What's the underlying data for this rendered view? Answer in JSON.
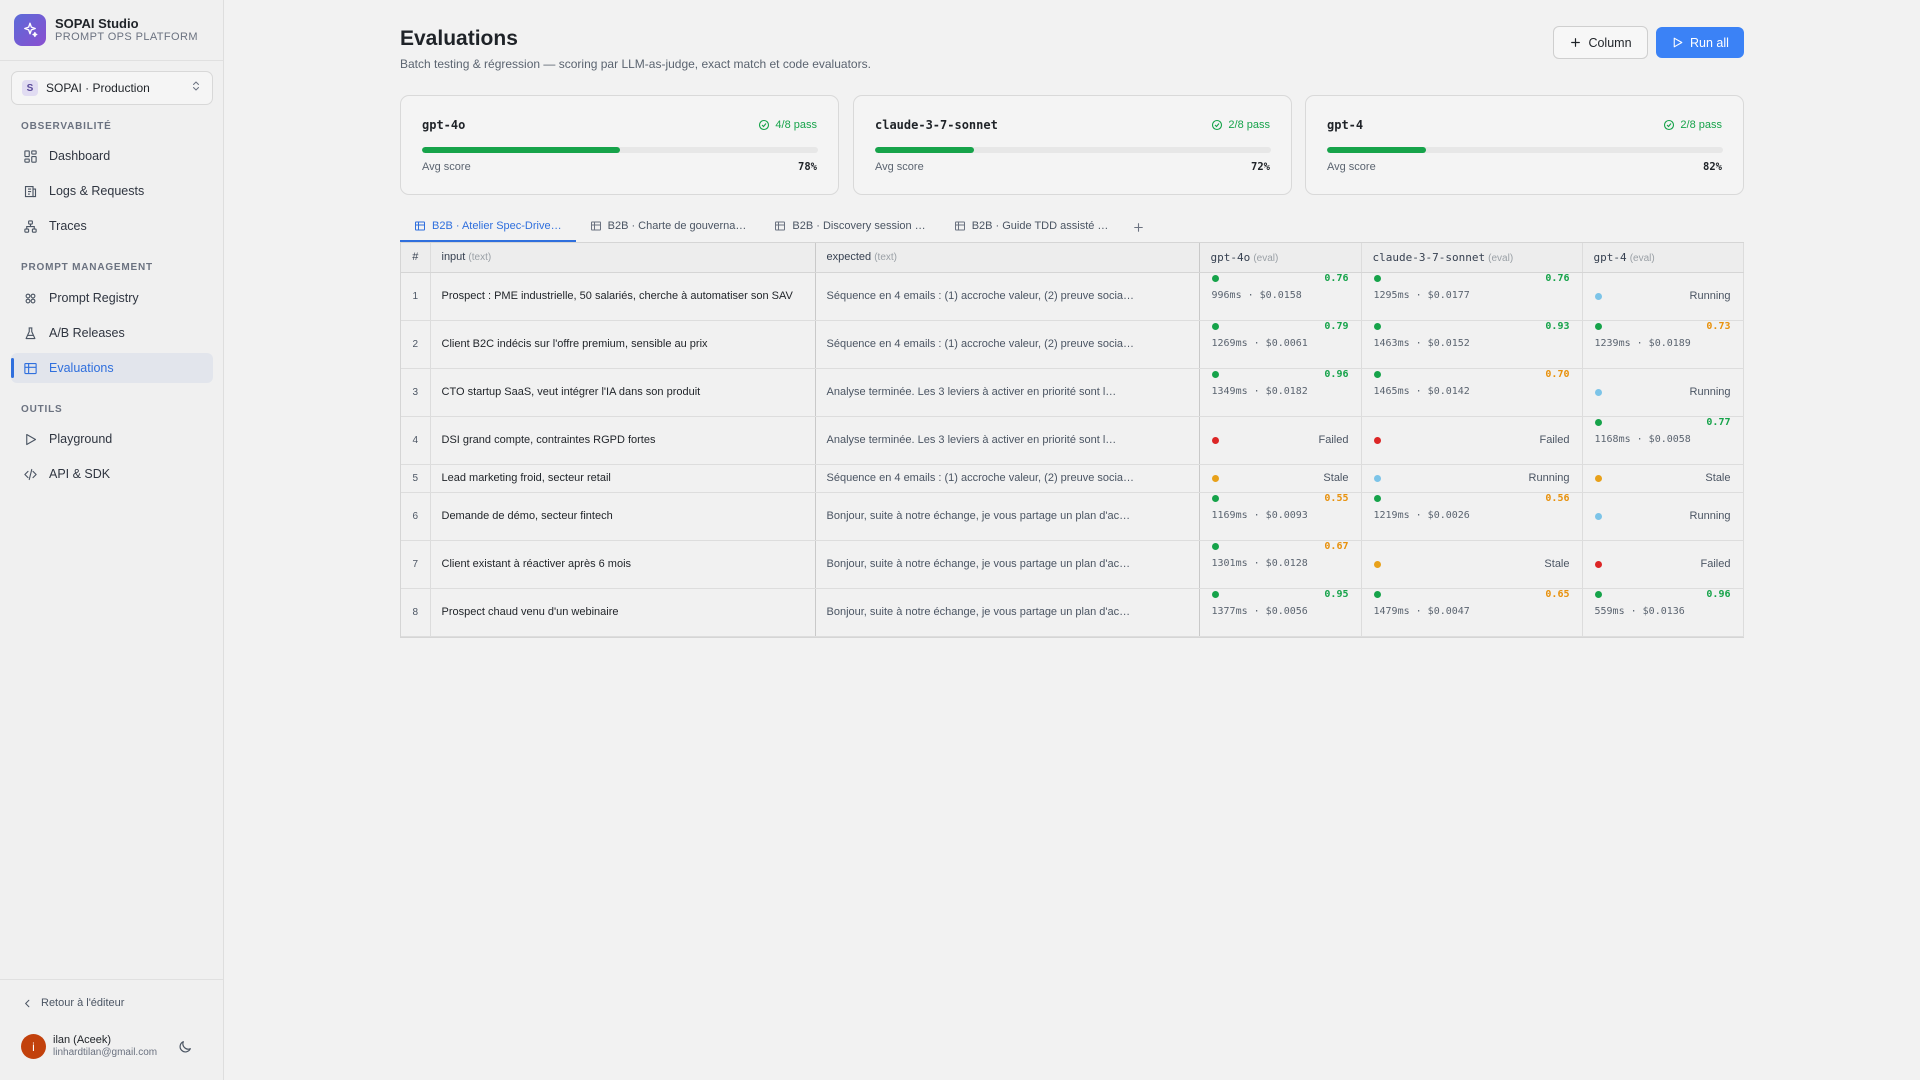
{
  "app": {
    "name": "SOPAI Studio",
    "subtitle": "PROMPT OPS PLATFORM"
  },
  "workspace": {
    "badge": "S",
    "label": "SOPAI · Production"
  },
  "sidebar": {
    "sections": [
      {
        "title": "OBSERVABILITÉ",
        "items": [
          {
            "label": "Dashboard",
            "icon": "dashboard-icon"
          },
          {
            "label": "Logs & Requests",
            "icon": "logs-icon"
          },
          {
            "label": "Traces",
            "icon": "traces-icon"
          }
        ]
      },
      {
        "title": "PROMPT MANAGEMENT",
        "items": [
          {
            "label": "Prompt Registry",
            "icon": "registry-icon"
          },
          {
            "label": "A/B Releases",
            "icon": "flask-icon"
          },
          {
            "label": "Evaluations",
            "icon": "table-icon",
            "active": true
          }
        ]
      },
      {
        "title": "OUTILS",
        "items": [
          {
            "label": "Playground",
            "icon": "play-icon"
          },
          {
            "label": "API & SDK",
            "icon": "code-icon"
          }
        ]
      }
    ],
    "back_link": "Retour à l'éditeur",
    "user": {
      "initial": "i",
      "name": "ilan (Aceek)",
      "email": "linhardtilan@gmail.com"
    }
  },
  "page": {
    "title": "Evaluations",
    "subtitle": "Batch testing & régression — scoring par LLM-as-judge, exact match et code evaluators.",
    "column_button": "Column",
    "run_button": "Run all"
  },
  "models": [
    {
      "name": "gpt-4o",
      "pass": "4/8 pass",
      "avg_label": "Avg score",
      "avg_value": "78%",
      "progress": 0.5
    },
    {
      "name": "claude-3-7-sonnet",
      "pass": "2/8 pass",
      "avg_label": "Avg score",
      "avg_value": "72%",
      "progress": 0.25
    },
    {
      "name": "gpt-4",
      "pass": "2/8 pass",
      "avg_label": "Avg score",
      "avg_value": "82%",
      "progress": 0.25
    }
  ],
  "tabs": [
    {
      "label": "B2B · Atelier Spec-Drive…",
      "active": true
    },
    {
      "label": "B2B · Charte de gouverna…"
    },
    {
      "label": "B2B · Discovery session …"
    },
    {
      "label": "B2B · Guide TDD assisté …"
    }
  ],
  "table": {
    "headers": {
      "num": "#",
      "input": "input",
      "input_hint": "(text)",
      "expected": "expected",
      "expected_hint": "(text)",
      "m1": "gpt-4o",
      "m2": "claude-3-7-sonnet",
      "m3": "gpt-4",
      "eval_hint": "(eval)"
    },
    "status_colors": {
      "pass": "#16a34a",
      "warn": "#ea9a0c",
      "fail": "#dc2626",
      "running": "#7cc4e8",
      "stale": "#e8a11a"
    },
    "score_colors": {
      "pass": "#16a34a",
      "warn": "#e8910c"
    },
    "rows": [
      {
        "n": "1",
        "input": "Prospect : PME industrielle, 50 salariés, cherche à automatiser son SAV",
        "expected": "Séquence en 4 emails : (1) accroche valeur, (2) preuve socia…",
        "cells": [
          {
            "kind": "score",
            "score": "0.76",
            "level": "pass",
            "meta": "996ms · $0.0158"
          },
          {
            "kind": "score",
            "score": "0.76",
            "level": "pass",
            "meta": "1295ms · $0.0177"
          },
          {
            "kind": "status",
            "status": "Running",
            "level": "running"
          }
        ]
      },
      {
        "n": "2",
        "input": "Client B2C indécis sur l'offre premium, sensible au prix",
        "expected": "Séquence en 4 emails : (1) accroche valeur, (2) preuve socia…",
        "cells": [
          {
            "kind": "score",
            "score": "0.79",
            "level": "pass",
            "meta": "1269ms · $0.0061"
          },
          {
            "kind": "score",
            "score": "0.93",
            "level": "pass",
            "meta": "1463ms · $0.0152"
          },
          {
            "kind": "score",
            "score": "0.73",
            "level": "warn",
            "dot": "pass",
            "meta": "1239ms · $0.0189"
          }
        ]
      },
      {
        "n": "3",
        "input": "CTO startup SaaS, veut intégrer l'IA dans son produit",
        "expected": "Analyse terminée. Les 3 leviers à activer en priorité sont l…",
        "cells": [
          {
            "kind": "score",
            "score": "0.96",
            "level": "pass",
            "meta": "1349ms · $0.0182"
          },
          {
            "kind": "score",
            "score": "0.70",
            "level": "warn",
            "dot": "pass",
            "meta": "1465ms · $0.0142"
          },
          {
            "kind": "status",
            "status": "Running",
            "level": "running"
          }
        ]
      },
      {
        "n": "4",
        "input": "DSI grand compte, contraintes RGPD fortes",
        "expected": "Analyse terminée. Les 3 leviers à activer en priorité sont l…",
        "cells": [
          {
            "kind": "status",
            "status": "Failed",
            "level": "fail"
          },
          {
            "kind": "status",
            "status": "Failed",
            "level": "fail"
          },
          {
            "kind": "score",
            "score": "0.77",
            "level": "pass",
            "meta": "1168ms · $0.0058"
          }
        ]
      },
      {
        "n": "5",
        "input": "Lead marketing froid, secteur retail",
        "expected": "Séquence en 4 emails : (1) accroche valeur, (2) preuve socia…",
        "cells": [
          {
            "kind": "status",
            "status": "Stale",
            "level": "stale"
          },
          {
            "kind": "status",
            "status": "Running",
            "level": "running"
          },
          {
            "kind": "status",
            "status": "Stale",
            "level": "stale"
          }
        ]
      },
      {
        "n": "6",
        "input": "Demande de démo, secteur fintech",
        "expected": "Bonjour, suite à notre échange, je vous partage un plan d'ac…",
        "cells": [
          {
            "kind": "score",
            "score": "0.55",
            "level": "warn",
            "dot": "pass",
            "meta": "1169ms · $0.0093"
          },
          {
            "kind": "score",
            "score": "0.56",
            "level": "warn",
            "dot": "pass",
            "meta": "1219ms · $0.0026"
          },
          {
            "kind": "status",
            "status": "Running",
            "level": "running"
          }
        ]
      },
      {
        "n": "7",
        "input": "Client existant à réactiver après 6 mois",
        "expected": "Bonjour, suite à notre échange, je vous partage un plan d'ac…",
        "cells": [
          {
            "kind": "score",
            "score": "0.67",
            "level": "warn",
            "dot": "pass",
            "meta": "1301ms · $0.0128"
          },
          {
            "kind": "status",
            "status": "Stale",
            "level": "stale"
          },
          {
            "kind": "status",
            "status": "Failed",
            "level": "fail"
          }
        ]
      },
      {
        "n": "8",
        "input": "Prospect chaud venu d'un webinaire",
        "expected": "Bonjour, suite à notre échange, je vous partage un plan d'ac…",
        "cells": [
          {
            "kind": "score",
            "score": "0.95",
            "level": "pass",
            "meta": "1377ms · $0.0056"
          },
          {
            "kind": "score",
            "score": "0.65",
            "level": "warn",
            "dot": "pass",
            "meta": "1479ms · $0.0047"
          },
          {
            "kind": "score",
            "score": "0.96",
            "level": "pass",
            "meta": "559ms · $0.0136"
          }
        ]
      }
    ]
  }
}
